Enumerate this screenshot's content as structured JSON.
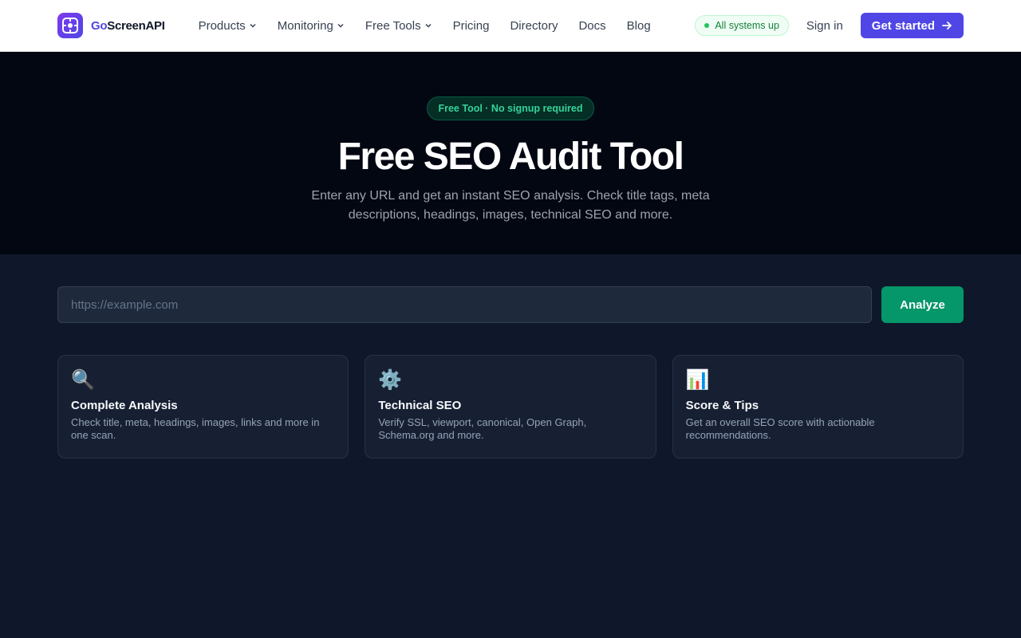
{
  "header": {
    "logo_prefix": "Go",
    "logo_suffix": "ScreenAPI",
    "nav": [
      {
        "label": "Products",
        "dropdown": true
      },
      {
        "label": "Monitoring",
        "dropdown": true
      },
      {
        "label": "Free Tools",
        "dropdown": true
      },
      {
        "label": "Pricing",
        "dropdown": false
      },
      {
        "label": "Directory",
        "dropdown": false
      },
      {
        "label": "Docs",
        "dropdown": false
      },
      {
        "label": "Blog",
        "dropdown": false
      }
    ],
    "status": "All systems up",
    "signin": "Sign in",
    "cta": "Get started"
  },
  "hero": {
    "badge": "Free Tool · No signup required",
    "title": "Free SEO Audit Tool",
    "subtitle": "Enter any URL and get an instant SEO analysis. Check title tags, meta descriptions, headings, images, technical SEO and more."
  },
  "search": {
    "placeholder": "https://example.com",
    "value": "",
    "button": "Analyze"
  },
  "cards": [
    {
      "icon": "magnifier-icon",
      "glyph": "🔍",
      "title": "Complete Analysis",
      "desc": "Check title, meta, headings, images, links and more in one scan."
    },
    {
      "icon": "gear-icon",
      "glyph": "⚙️",
      "title": "Technical SEO",
      "desc": "Verify SSL, viewport, canonical, Open Graph, Schema.org and more."
    },
    {
      "icon": "bar-chart-icon",
      "glyph": "📊",
      "title": "Score & Tips",
      "desc": "Get an overall SEO score with actionable recommendations."
    }
  ],
  "colors": {
    "brand": "#4f46e5",
    "analyze": "#059669",
    "hero_bg": "#030712",
    "page_bg": "#0f172a"
  }
}
